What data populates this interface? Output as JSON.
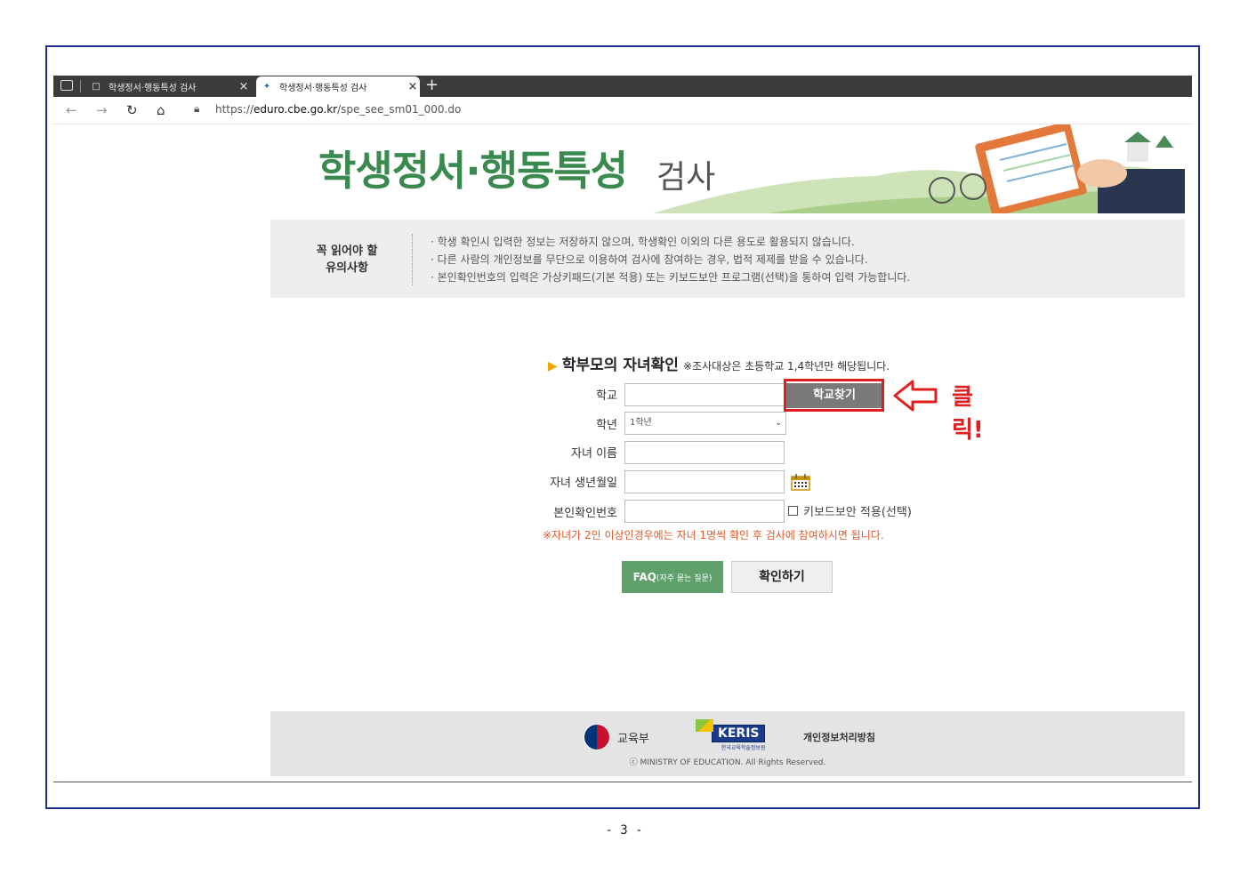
{
  "browser": {
    "tabs": [
      {
        "title": "학생정서·행동특성 검사",
        "close": "×"
      },
      {
        "title": "학생정서·행동특성 검사",
        "close": "×"
      }
    ],
    "new_tab": "+",
    "url_prefix": "https://",
    "url_host": "eduro.cbe.go.kr",
    "url_path": "/spe_see_sm01_000.do"
  },
  "header": {
    "title": "학생정서·행동특성",
    "subtitle": "검사"
  },
  "notice": {
    "label_line1": "꼭 읽어야 할",
    "label_line2": "유의사항",
    "items": [
      "· 학생 확인시 입력한 정보는 저장하지 않으며, 학생확인 이외의 다른 용도로 활용되지 않습니다.",
      "· 다른 사람의 개인정보를 무단으로 이용하여 검사에 참여하는 경우, 법적 제제를 받을 수 있습니다.",
      "· 본인확인번호의 입력은 가상키패드(기본 적용) 또는 키보드보안 프로그램(선택)을 통하여 입력 가능합니다."
    ]
  },
  "form": {
    "title": "학부모의 자녀확인",
    "title_note": "※조사대상은 초등학교 1,4학년만 해당됩니다.",
    "school_label": "학교",
    "school_value": "",
    "find_school_button": "학교찾기",
    "grade_label": "학년",
    "grade_selected": "1학년",
    "name_label": "자녀 이름",
    "name_value": "",
    "birth_label": "자녀 생년월일",
    "birth_value": "",
    "id_label": "본인확인번호",
    "id_value": "",
    "keyboard_security_label": "키보드보안 적용(선택)",
    "warning": "※자녀가 2인 이상인경우에는 자녀 1명씩 확인 후 검사에 참여하시면 됩니다.",
    "faq_button": "FAQ",
    "faq_button_sub": "(자주 묻는 질문)",
    "confirm_button": "확인하기"
  },
  "annotation": {
    "click_text": "클릭!",
    "color": "#e02020"
  },
  "footer": {
    "moe": "교육부",
    "keris": "KERIS",
    "keris_sub": "한국교육학술정보원",
    "privacy": "개인정보처리방침",
    "copyright": "ⓒ MINISTRY OF EDUCATION. All Rights Reserved."
  },
  "page_number": "- 3 -",
  "colors": {
    "brand_green": "#3a8a50",
    "frame_border": "#1f2f8f",
    "warning": "#e05a2a"
  }
}
